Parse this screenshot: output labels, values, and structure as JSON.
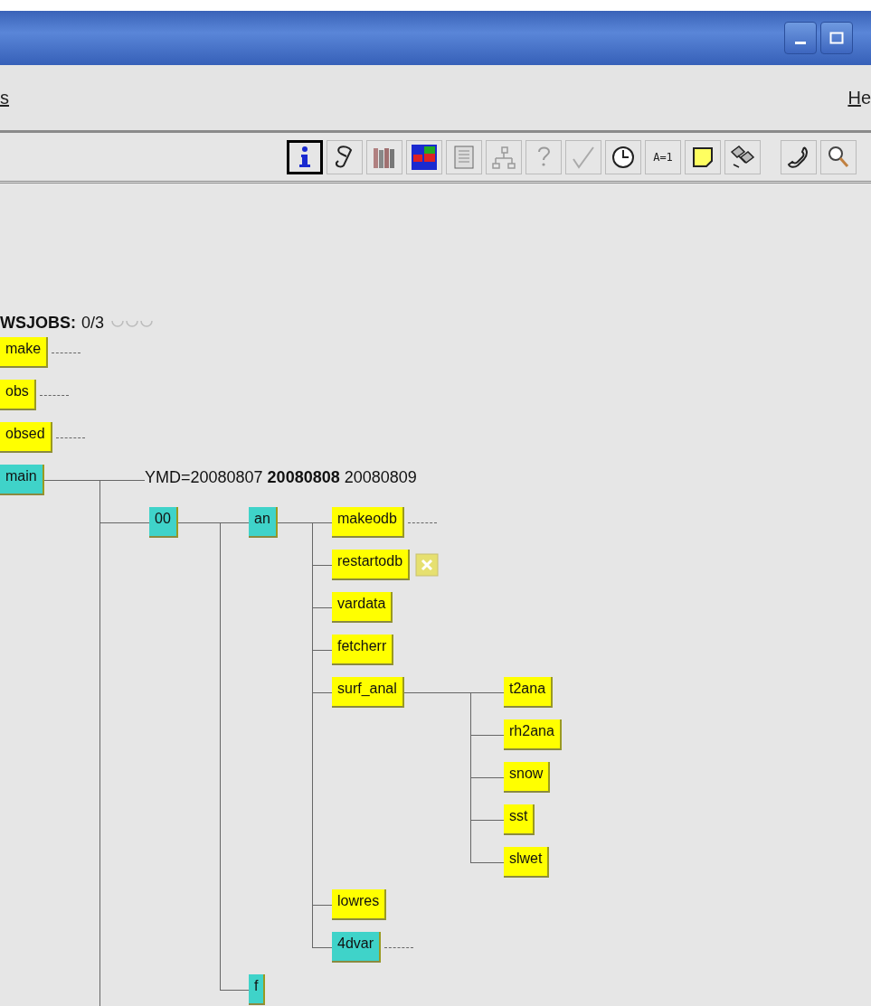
{
  "menu": [
    {
      "label": "s"
    },
    {
      "label": "He"
    }
  ],
  "toolbar": [
    {
      "selected": true
    },
    {
      "selected": false
    },
    {
      "selected": false
    },
    {
      "selected": false
    },
    {
      "selected": false
    },
    {
      "selected": false
    },
    {
      "selected": false
    },
    {
      "selected": false
    },
    {
      "selected": false
    },
    {
      "label": "A=1",
      "selected": false
    },
    {
      "selected": false
    },
    {
      "selected": false
    },
    {
      "selected": false
    },
    {
      "selected": false
    }
  ],
  "suite": {
    "name": "WSJOBS:",
    "jobs": "0/3"
  },
  "tree": [
    {
      "kind": "node",
      "name": "make",
      "color": "#ffff00",
      "collapsed": true
    },
    {
      "kind": "node",
      "name": "obs",
      "color": "#ffff00",
      "collapsed": true
    },
    {
      "kind": "node",
      "name": "obsed",
      "color": "#ffff00",
      "collapsed": true
    },
    {
      "kind": "node",
      "name": "main",
      "color": "#3fd3c9",
      "children": [
        {
          "kind": "repeat",
          "text": "YMD=20080807 **20080808** 20080809"
        },
        {
          "kind": "node",
          "name": "00",
          "color": "#3fd3c9",
          "children": [
            {
              "kind": "node",
              "name": "an",
              "color": "#3fd3c9",
              "children": [
                {
                  "kind": "node",
                  "name": "makeodb",
                  "color": "#ffff00",
                  "collapsed": true
                },
                {
                  "kind": "node",
                  "name": "restartodb",
                  "color": "#ffff00",
                  "flagged": true
                },
                {
                  "kind": "node",
                  "name": "vardata",
                  "color": "#ffff00"
                },
                {
                  "kind": "node",
                  "name": "fetcherr",
                  "color": "#ffff00"
                },
                {
                  "kind": "node",
                  "name": "surf_anal",
                  "color": "#ffff00",
                  "children": [
                    {
                      "kind": "node",
                      "name": "t2ana",
                      "color": "#ffff00"
                    },
                    {
                      "kind": "node",
                      "name": "rh2ana",
                      "color": "#ffff00"
                    },
                    {
                      "kind": "node",
                      "name": "snow",
                      "color": "#ffff00"
                    },
                    {
                      "kind": "node",
                      "name": "sst",
                      "color": "#ffff00"
                    },
                    {
                      "kind": "node",
                      "name": "slwet",
                      "color": "#ffff00"
                    }
                  ]
                },
                {
                  "kind": "node",
                  "name": "lowres",
                  "color": "#ffff00"
                },
                {
                  "kind": "node",
                  "name": "4dvar",
                  "color": "#3fd3c9",
                  "collapsed": true
                }
              ]
            },
            {
              "kind": "node",
              "name": "f",
              "color": "#3fd3c9"
            }
          ]
        }
      ]
    }
  ]
}
